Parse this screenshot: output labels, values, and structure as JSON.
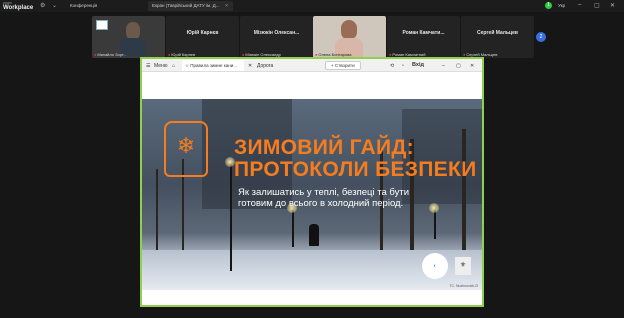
{
  "app": {
    "logo_top": "zoom",
    "logo_bottom": "Workplace"
  },
  "tabs": [
    {
      "label": "Конференція"
    },
    {
      "label": "Екран (Таврійський ДАТУ ім. Д..."
    }
  ],
  "status": {
    "notifications": "1",
    "language": "Укр"
  },
  "participants": [
    {
      "name": "",
      "label": "Михайло Зорт...",
      "video": true
    },
    {
      "name": "Юрій Карнєв",
      "label": "Юрій Карнєв",
      "video": false
    },
    {
      "name": "Мізюкін Олексан...",
      "label": "Мізюкін Олександр",
      "video": false
    },
    {
      "name": "",
      "label": "Олена Бонтарова",
      "video": true
    },
    {
      "name": "Роман Камчати...",
      "label": "Роман Камчатний",
      "video": false
    },
    {
      "name": "Сергей Мальцев",
      "label": "Сергей Мальцев",
      "video": false
    }
  ],
  "more_participants": "2",
  "shared": {
    "menu_label": "Меню",
    "tab_title": "Правила зимне кани...",
    "tab_doroga": "Дорога",
    "new_button": "+ Створити",
    "exit_label": "Вхід"
  },
  "slide": {
    "title_line1": "ЗИМОВИЙ ГАЙД:",
    "title_line2": "ПРОТОКОЛИ БЕЗПЕКИ",
    "subtitle": "Як залишатись у теплі, безпеці та бути готовим до всього в холодний період.",
    "credit": "TC. Nuzhnovich-D"
  }
}
